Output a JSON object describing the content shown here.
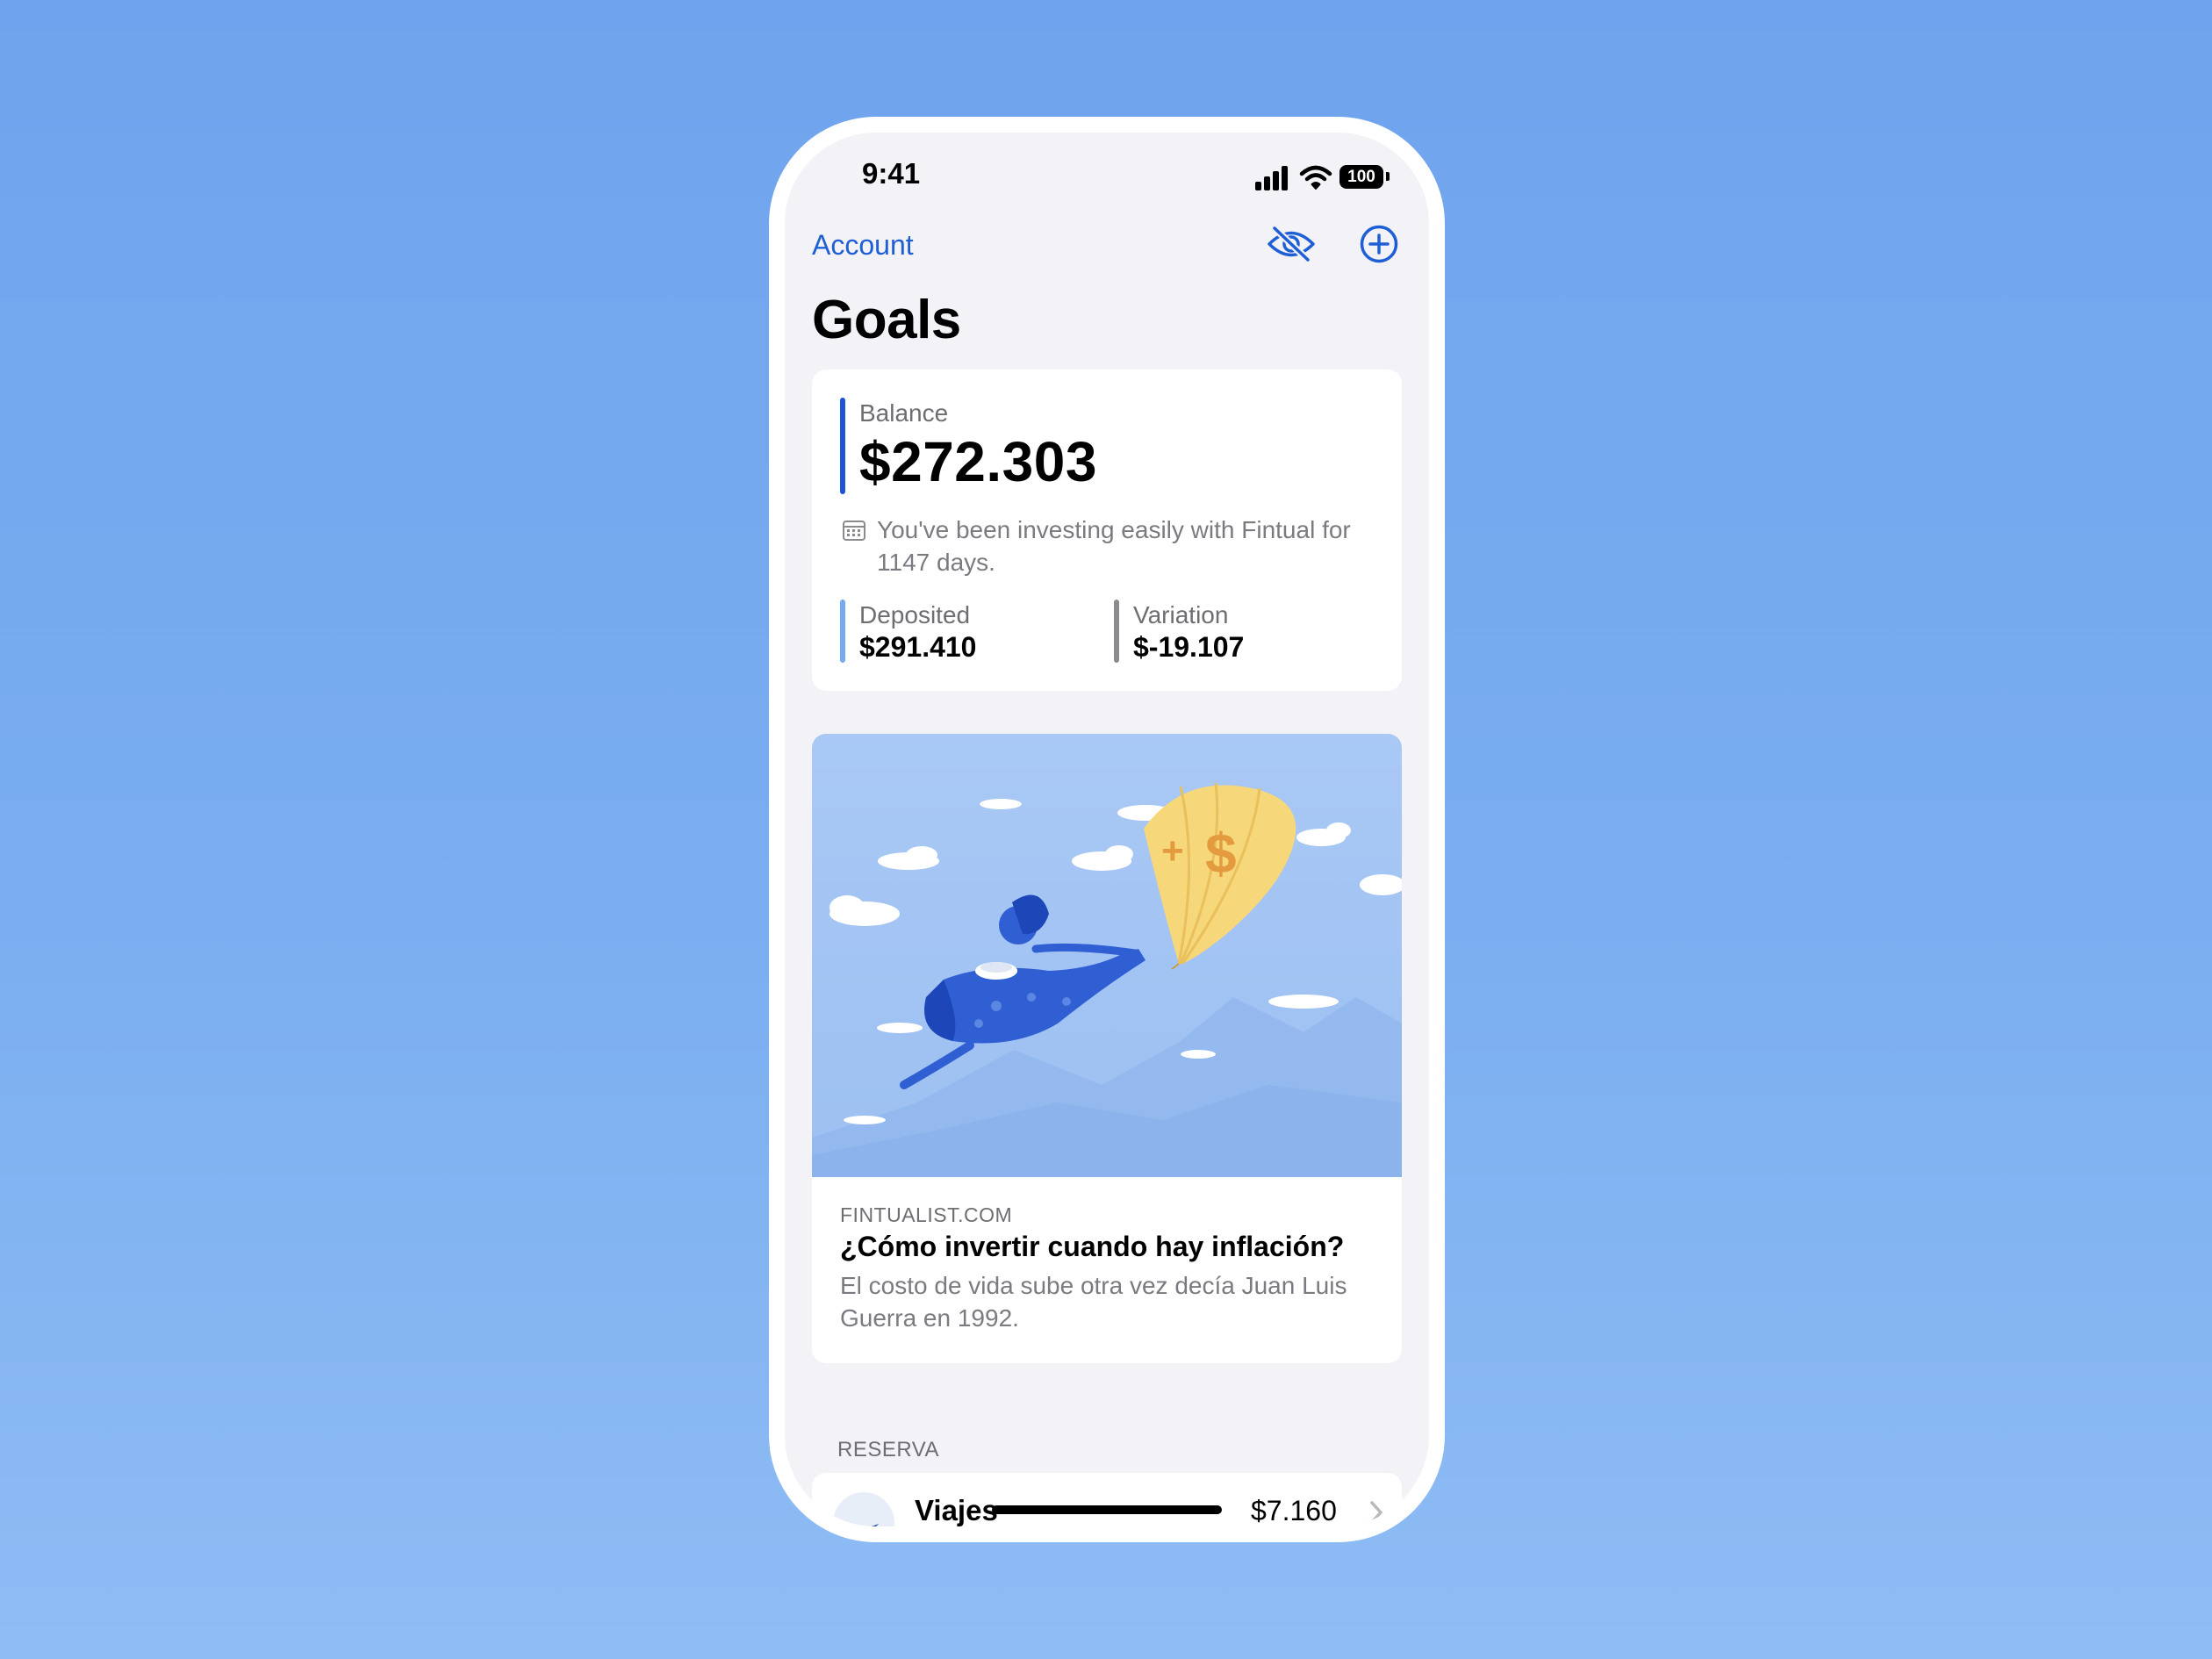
{
  "status_bar": {
    "time": "9:41",
    "battery": "100"
  },
  "nav": {
    "back_label": "Account"
  },
  "header": {
    "title": "Goals"
  },
  "balance": {
    "label": "Balance",
    "value": "$272.303",
    "investing_note": "You've been investing easily with Fintual for 1147 days.",
    "deposited_label": "Deposited",
    "deposited_value": "$291.410",
    "variation_label": "Variation",
    "variation_value": "$-19.107",
    "accent_color": "#1c54d3"
  },
  "article": {
    "source": "FINTUALIST.COM",
    "title": "¿Cómo invertir cuando hay inflación?",
    "description": "El costo de vida sube otra vez decía Juan Luis Guerra en 1992."
  },
  "section": {
    "header": "RESERVA"
  },
  "goals": [
    {
      "name": "Viajes",
      "amount": "$7.160",
      "icon": "paper-plane-icon"
    }
  ],
  "icons": [
    "signal-icon",
    "wifi-icon",
    "battery-icon",
    "eye-slash-icon",
    "plus-circle-icon",
    "calendar-icon",
    "chevron-right-icon"
  ]
}
